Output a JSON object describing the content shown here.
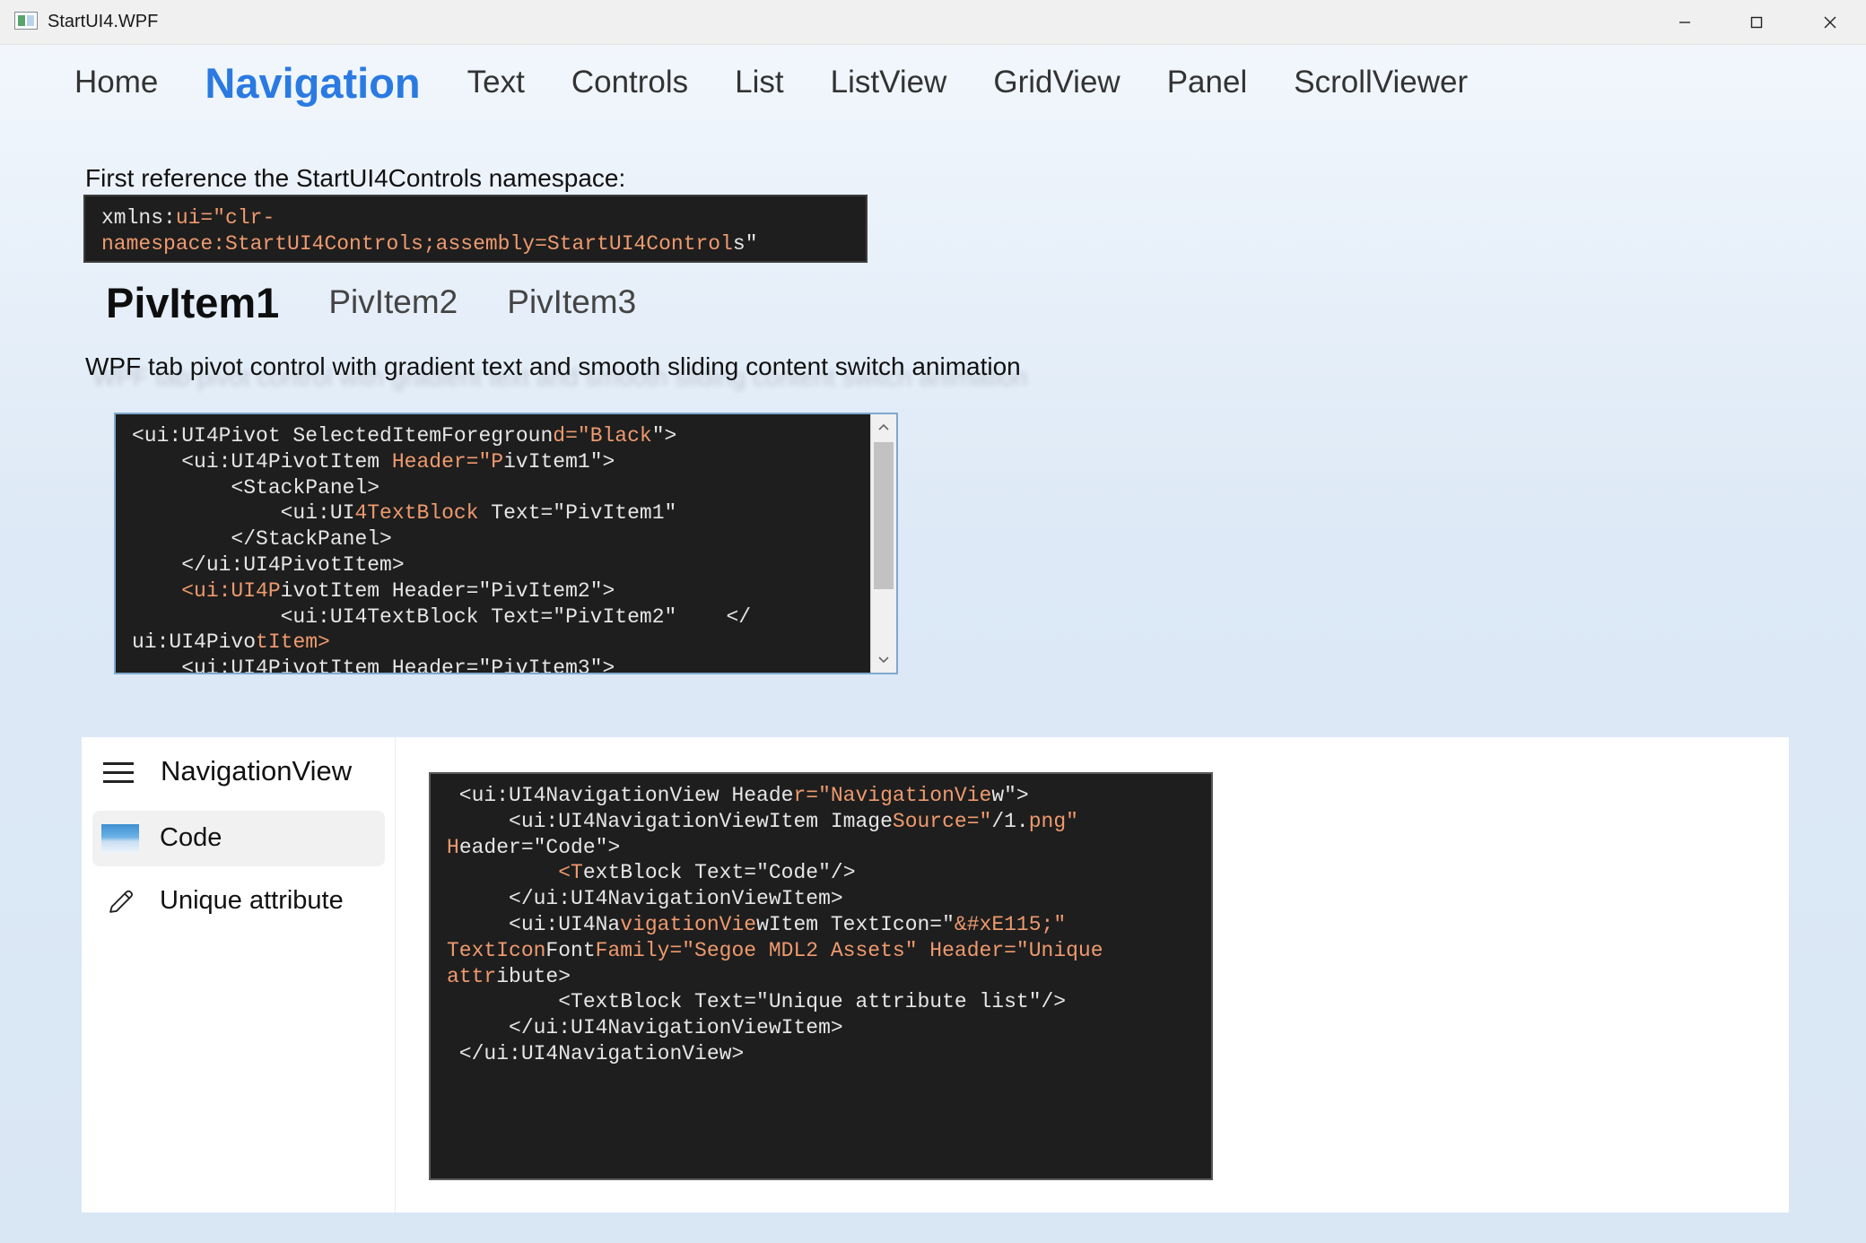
{
  "window": {
    "title": "StartUI4.WPF",
    "minimize_icon": "minimize-icon",
    "maximize_icon": "maximize-icon",
    "close_icon": "close-icon"
  },
  "nav_tabs": [
    {
      "label": "Home",
      "selected": false
    },
    {
      "label": "Navigation",
      "selected": true
    },
    {
      "label": "Text",
      "selected": false
    },
    {
      "label": "Controls",
      "selected": false
    },
    {
      "label": "List",
      "selected": false
    },
    {
      "label": "ListView",
      "selected": false
    },
    {
      "label": "GridView",
      "selected": false
    },
    {
      "label": "Panel",
      "selected": false
    },
    {
      "label": "ScrollViewer",
      "selected": false
    }
  ],
  "intro": {
    "text": "First reference the StartUI4Controls namespace:",
    "code_line1_a": "xmlns:",
    "code_line1_b": "ui=\"clr-",
    "code_line2_a": "namespace:StartUI4Controls;assembly=StartUI4Control",
    "code_line2_b": "s\""
  },
  "pivot": {
    "items": [
      {
        "label": "PivItem1",
        "selected": true
      },
      {
        "label": "PivItem2",
        "selected": false
      },
      {
        "label": "PivItem3",
        "selected": false
      }
    ],
    "description": "WPF tab pivot control with gradient text and smooth sliding content switch animation",
    "code": {
      "l1a": "<ui:UI4Pivot SelectedItemForegroun",
      "l1b": "d=\"Black",
      "l1c": "\">",
      "l2a": "    <ui:UI4PivotItem ",
      "l2b": "Header=\"P",
      "l2c": "ivItem1\">",
      "l3": "        <StackPanel>",
      "l4a": "            <ui:UI",
      "l4b": "4TextBlock",
      "l4c": " Text=\"PivItem1\"",
      "l5": "        </StackPanel>",
      "l6": "    </ui:UI4PivotItem>",
      "l7a": "    ",
      "l7b": "<ui:UI4P",
      "l7c": "ivotItem Header=\"PivItem2\">",
      "l8": "            <ui:UI4TextBlock Text=\"PivItem2\"    </",
      "l9a": "ui:UI4Pivo",
      "l9b": "tItem>",
      "l10": "    <ui:UI4PivotItem Header=\"PivItem3\">"
    }
  },
  "navview": {
    "menu_icon": "hamburger-icon",
    "title": "NavigationView",
    "items": [
      {
        "label": "Code",
        "icon": "image-icon",
        "selected": true
      },
      {
        "label": "Unique attribute",
        "icon": "pencil-icon",
        "selected": false
      }
    ],
    "code": {
      "l1a": " <ui:UI4NavigationView Heade",
      "l1b": "r=\"NavigationVie",
      "l1c": "w\">",
      "l2a": "     <ui:UI4NavigationViewItem Image",
      "l2b": "Source=\"",
      "l2c": "/1.",
      "l2d": "png\"",
      "l3a": "H",
      "l3b": "eader=\"Code\">",
      "l4a": "         ",
      "l4b": "<T",
      "l4c": "extBlock Text=\"Code\"/>",
      "l5": "     </ui:UI4NavigationViewItem>",
      "l6a": "     <ui:UI4Na",
      "l6b": "vigationVie",
      "l6c": "wItem TextIcon=\"",
      "l6d": "&#xE115;\"",
      "l7a": "TextIcon",
      "l7b": "Font",
      "l7c": "Family=\"Segoe MDL2 Assets\" Header=\"Unique",
      "l8a": "attr",
      "l8b": "ibute>",
      "l9": "         <TextBlock Text=\"Unique attribute list\"/>",
      "l10": "     </ui:UI4NavigationViewItem>",
      "l11": " </ui:UI4NavigationView>"
    }
  },
  "colors": {
    "accent": "#2a7ae2",
    "code_background": "#1e1e1e",
    "code_keyword": "#ef9a6e",
    "code_text": "#e6e6e6"
  }
}
